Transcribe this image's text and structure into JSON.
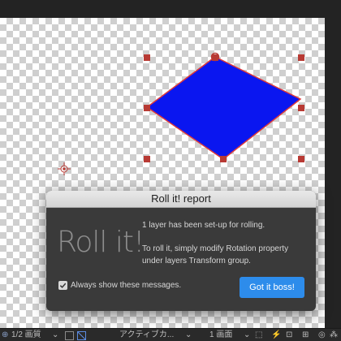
{
  "dialog": {
    "title": "Roll it! report",
    "logo_text": "Roll it!",
    "message_line1": "1 layer has been set-up for rolling.",
    "message_line2": "To roll it, simply modify Rotation property under layers Transform group.",
    "checkbox_label": "Always show these messages.",
    "checkbox_checked": true,
    "ok_button_label": "Got it boss!"
  },
  "shape": {
    "fill_color": "#0a16f0",
    "stroke_color": "#e03a3a",
    "handle_color": "#b83a34"
  },
  "toolbar": {
    "resolution": "1/2 画質",
    "camera": "アクティブカ...",
    "view_count": "1 画面"
  }
}
